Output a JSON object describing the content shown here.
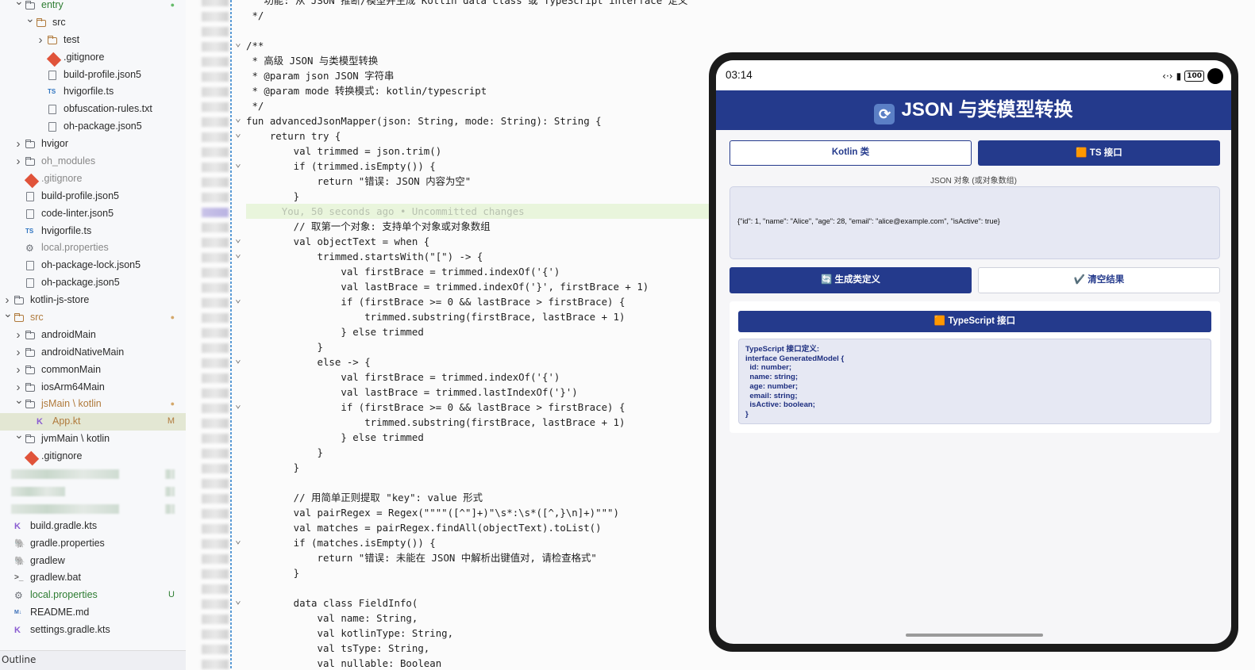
{
  "sidebar": {
    "rows": [
      {
        "label": "entry",
        "type": "folder",
        "depth": 1,
        "chev": "v",
        "badge": "●",
        "color": "#2e7d32",
        "badgeColor": "#66bb6a"
      },
      {
        "label": "src",
        "type": "srcfolder",
        "depth": 2,
        "chev": "v",
        "color": "#2b2b2b"
      },
      {
        "label": "test",
        "type": "srcfolder",
        "depth": 3,
        "chev": ">",
        "color": "#2b2b2b"
      },
      {
        "label": ".gitignore",
        "type": "git",
        "depth": 3,
        "color": "#2b2b2b"
      },
      {
        "label": "build-profile.json5",
        "type": "file",
        "depth": 3,
        "color": "#2b2b2b"
      },
      {
        "label": "hvigorfile.ts",
        "type": "ts",
        "depth": 3,
        "color": "#2b2b2b"
      },
      {
        "label": "obfuscation-rules.txt",
        "type": "file",
        "depth": 3,
        "color": "#2b2b2b"
      },
      {
        "label": "oh-package.json5",
        "type": "file",
        "depth": 3,
        "color": "#2b2b2b"
      },
      {
        "label": "hvigor",
        "type": "folder",
        "depth": 1,
        "chev": ">",
        "color": "#2b2b2b"
      },
      {
        "label": "oh_modules",
        "type": "folder",
        "depth": 1,
        "chev": ">",
        "color": "#888"
      },
      {
        "label": ".gitignore",
        "type": "git",
        "depth": 1,
        "color": "#888"
      },
      {
        "label": "build-profile.json5",
        "type": "file",
        "depth": 1,
        "color": "#2b2b2b"
      },
      {
        "label": "code-linter.json5",
        "type": "file",
        "depth": 1,
        "color": "#2b2b2b"
      },
      {
        "label": "hvigorfile.ts",
        "type": "ts",
        "depth": 1,
        "color": "#2b2b2b"
      },
      {
        "label": "local.properties",
        "type": "gear",
        "depth": 1,
        "color": "#888"
      },
      {
        "label": "oh-package-lock.json5",
        "type": "file",
        "depth": 1,
        "color": "#2b2b2b"
      },
      {
        "label": "oh-package.json5",
        "type": "file",
        "depth": 1,
        "color": "#2b2b2b"
      },
      {
        "label": "kotlin-js-store",
        "type": "folder",
        "depth": 0,
        "chev": ">",
        "color": "#2b2b2b"
      },
      {
        "label": "src",
        "type": "srcfolder",
        "depth": 0,
        "chev": "v",
        "badge": "●",
        "color": "#b07a3c",
        "badgeColor": "#d4a86a"
      },
      {
        "label": "androidMain",
        "type": "folder",
        "depth": 1,
        "chev": ">",
        "color": "#2b2b2b"
      },
      {
        "label": "androidNativeMain",
        "type": "folder",
        "depth": 1,
        "chev": ">",
        "color": "#2b2b2b"
      },
      {
        "label": "commonMain",
        "type": "folder",
        "depth": 1,
        "chev": ">",
        "color": "#2b2b2b"
      },
      {
        "label": "iosArm64Main",
        "type": "folder",
        "depth": 1,
        "chev": ">",
        "color": "#2b2b2b"
      },
      {
        "label": "jsMain \\ kotlin",
        "type": "folder",
        "depth": 1,
        "chev": "v",
        "badge": "●",
        "color": "#b07a3c",
        "badgeColor": "#d4a86a"
      },
      {
        "label": "App.kt",
        "type": "kt",
        "depth": 2,
        "badge": "M",
        "color": "#b07a3c",
        "badgeColor": "#b07a3c",
        "selected": true
      },
      {
        "label": "jvmMain \\ kotlin",
        "type": "folder",
        "depth": 1,
        "chev": "v",
        "color": "#2b2b2b"
      },
      {
        "label": ".gitignore",
        "type": "git",
        "depth": 1,
        "color": "#2b2b2b"
      },
      {
        "label": "",
        "type": "blur",
        "depth": 0,
        "color": "#2b2b2b"
      },
      {
        "label": "",
        "type": "blur",
        "depth": 0,
        "color": "#2b2b2b"
      },
      {
        "label": "",
        "type": "blur",
        "depth": 0,
        "color": "#2b2b2b"
      },
      {
        "label": "build.gradle.kts",
        "type": "kt",
        "depth": 0,
        "color": "#2b2b2b"
      },
      {
        "label": "gradle.properties",
        "type": "gradle",
        "depth": 0,
        "color": "#2b2b2b"
      },
      {
        "label": "gradlew",
        "type": "gradle",
        "depth": 0,
        "color": "#2b2b2b"
      },
      {
        "label": "gradlew.bat",
        "type": "term",
        "depth": 0,
        "color": "#2b2b2b"
      },
      {
        "label": "local.properties",
        "type": "gear",
        "depth": 0,
        "badge": "U",
        "color": "#2e7d32",
        "badgeColor": "#2e7d32"
      },
      {
        "label": "README.md",
        "type": "md",
        "depth": 0,
        "color": "#2b2b2b"
      },
      {
        "label": "settings.gradle.kts",
        "type": "kt",
        "depth": 0,
        "color": "#2b2b2b"
      }
    ],
    "outline_label": "Outline"
  },
  "code": {
    "lines": [
      {
        "t": "   功能: 从 JSON 推断/模型并生成 Kotlin data class 或 TypeScript interface 定义",
        "indent": 0
      },
      {
        "t": " */",
        "indent": 0
      },
      {
        "t": "",
        "indent": 0
      },
      {
        "t": "/**",
        "indent": 0,
        "fold": true
      },
      {
        "t": " * 高级 JSON 与类模型转换",
        "indent": 0
      },
      {
        "t": " * @param json JSON 字符串",
        "indent": 0
      },
      {
        "t": " * @param mode 转换模式: kotlin/typescript",
        "indent": 0
      },
      {
        "t": " */",
        "indent": 0
      },
      {
        "t": "fun advancedJsonMapper(json: String, mode: String): String {",
        "indent": 0,
        "fold": true
      },
      {
        "t": "    return try {",
        "indent": 0,
        "fold": true
      },
      {
        "t": "        val trimmed = json.trim()",
        "indent": 0
      },
      {
        "t": "        if (trimmed.isEmpty()) {",
        "indent": 0,
        "fold": true
      },
      {
        "t": "            return \"错误: JSON 内容为空\"",
        "indent": 0
      },
      {
        "t": "        }",
        "indent": 0
      },
      {
        "t": "      You, 50 seconds ago • Uncommitted changes",
        "indent": 0,
        "ghost": true
      },
      {
        "t": "        // 取第一个对象: 支持单个对象或对象数组",
        "indent": 0
      },
      {
        "t": "        val objectText = when {",
        "indent": 0,
        "fold": true
      },
      {
        "t": "            trimmed.startsWith(\"[\") -> {",
        "indent": 0,
        "fold": true
      },
      {
        "t": "                val firstBrace = trimmed.indexOf('{')",
        "indent": 0
      },
      {
        "t": "                val lastBrace = trimmed.indexOf('}', firstBrace + 1)",
        "indent": 0
      },
      {
        "t": "                if (firstBrace >= 0 && lastBrace > firstBrace) {",
        "indent": 0,
        "fold": true
      },
      {
        "t": "                    trimmed.substring(firstBrace, lastBrace + 1)",
        "indent": 0
      },
      {
        "t": "                } else trimmed",
        "indent": 0
      },
      {
        "t": "            }",
        "indent": 0
      },
      {
        "t": "            else -> {",
        "indent": 0,
        "fold": true
      },
      {
        "t": "                val firstBrace = trimmed.indexOf('{')",
        "indent": 0
      },
      {
        "t": "                val lastBrace = trimmed.lastIndexOf('}')",
        "indent": 0
      },
      {
        "t": "                if (firstBrace >= 0 && lastBrace > firstBrace) {",
        "indent": 0,
        "fold": true
      },
      {
        "t": "                    trimmed.substring(firstBrace, lastBrace + 1)",
        "indent": 0
      },
      {
        "t": "                } else trimmed",
        "indent": 0
      },
      {
        "t": "            }",
        "indent": 0
      },
      {
        "t": "        }",
        "indent": 0
      },
      {
        "t": "",
        "indent": 0
      },
      {
        "t": "        // 用简单正则提取 \"key\": value 形式",
        "indent": 0
      },
      {
        "t": "        val pairRegex = Regex(\"\"\"\"([^\"]+)\"\\s*:\\s*([^,}\\n]+)\"\"\")",
        "indent": 0
      },
      {
        "t": "        val matches = pairRegex.findAll(objectText).toList()",
        "indent": 0
      },
      {
        "t": "        if (matches.isEmpty()) {",
        "indent": 0,
        "fold": true
      },
      {
        "t": "            return \"错误: 未能在 JSON 中解析出键值对, 请检查格式\"",
        "indent": 0
      },
      {
        "t": "        }",
        "indent": 0
      },
      {
        "t": "",
        "indent": 0
      },
      {
        "t": "        data class FieldInfo(",
        "indent": 0,
        "fold": true
      },
      {
        "t": "            val name: String,",
        "indent": 0
      },
      {
        "t": "            val kotlinType: String,",
        "indent": 0
      },
      {
        "t": "            val tsType: String,",
        "indent": 0
      },
      {
        "t": "            val nullable: Boolean",
        "indent": 0
      }
    ]
  },
  "phone": {
    "time": "03:14",
    "battery": "100",
    "title": "JSON 与类模型转换",
    "title_icon": "refresh-icon",
    "tab_kotlin": "Kotlin 类",
    "tab_ts": "🟧 TS 接口",
    "json_label": "JSON 对象 (或对象数组)",
    "json_value": "{\"id\": 1, \"name\": \"Alice\", \"age\": 28, \"email\": \"alice@example.com\", \"isActive\": true}",
    "generate_button": "🔄 生成类定义",
    "clear_button": "✔️ 清空结果",
    "result_header": "🟧 TypeScript 接口",
    "result_text": "TypeScript 接口定义:\ninterface GeneratedModel {\n  id: number;\n  name: string;\n  age: number;\n  email: string;\n  isActive: boolean;\n}",
    "accent": "#243a8c"
  }
}
